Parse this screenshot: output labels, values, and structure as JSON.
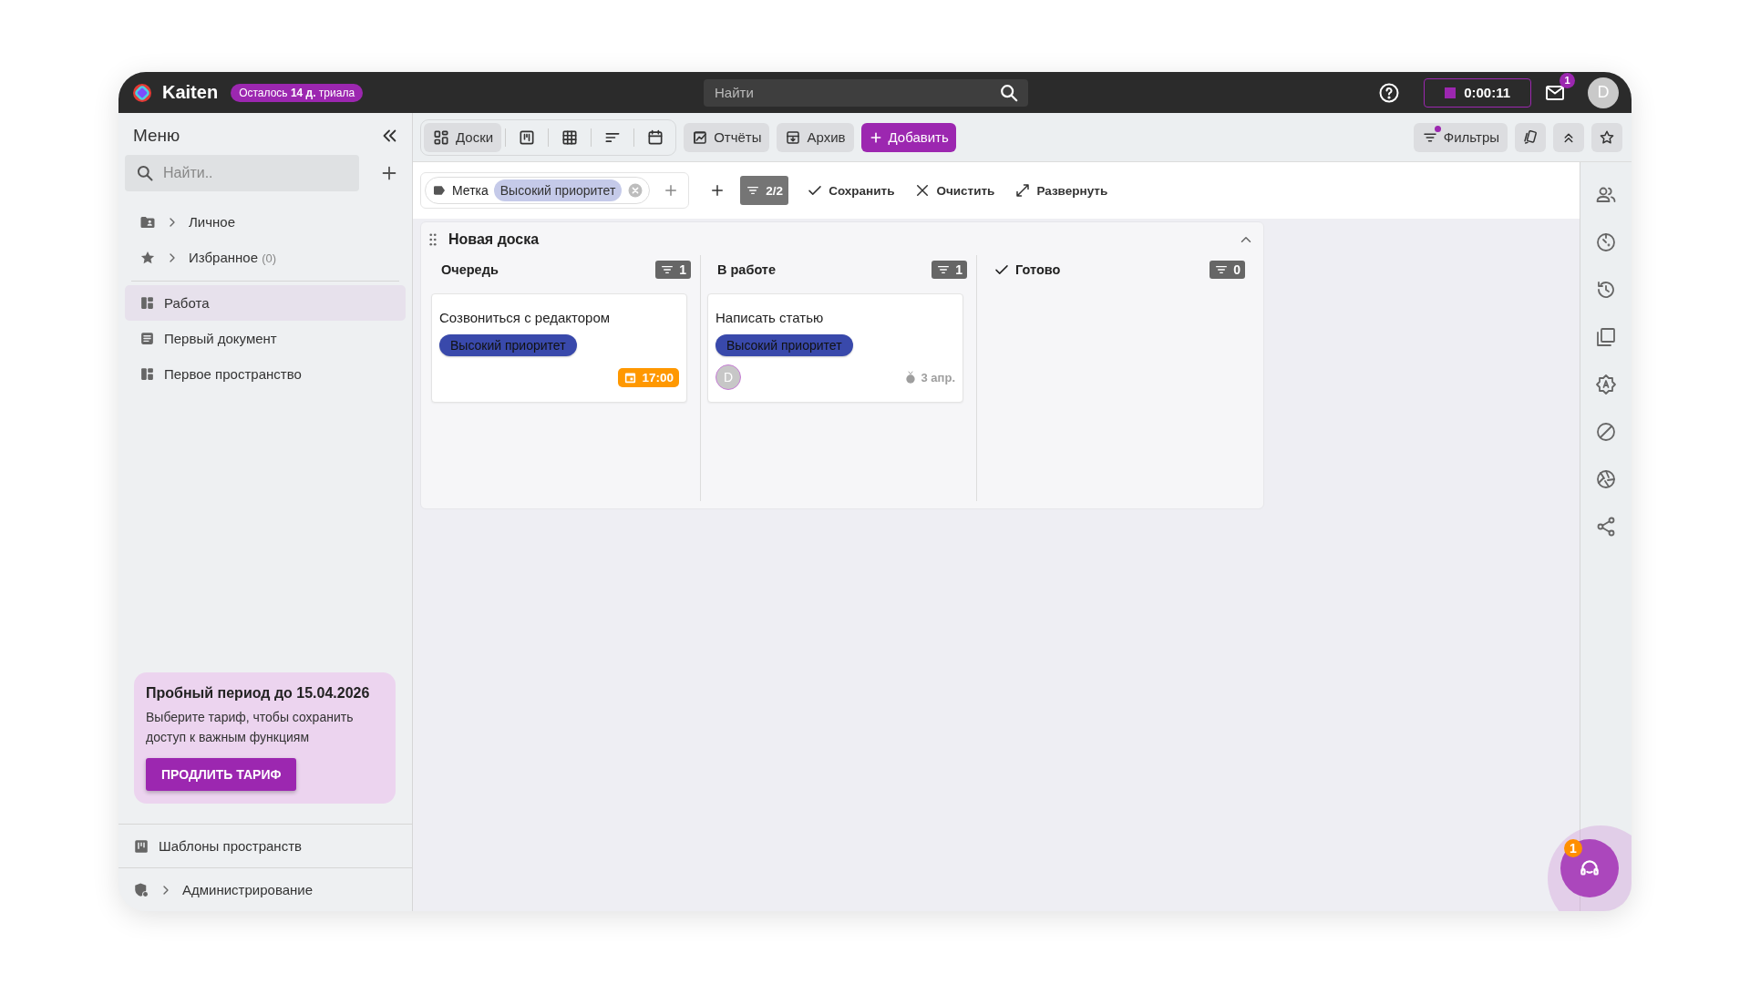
{
  "topbar": {
    "logo": "Kaiten",
    "trial_badge": "Осталось **14 д.** триала",
    "search": {
      "placeholder": "Найти"
    },
    "timer": "0:00:11",
    "mail_badge": "1",
    "avatar": "D"
  },
  "sidebar": {
    "title": "Меню",
    "search": {
      "placeholder": "Найти.."
    },
    "sections": [
      {
        "label": "Личное",
        "kind": "personal",
        "expanded": false
      },
      {
        "label": "Избранное",
        "count": "(0)",
        "kind": "favorites",
        "expanded": false
      }
    ],
    "items": [
      {
        "label": "Работа",
        "kind": "board",
        "selected": true
      },
      {
        "label": "Первый документ",
        "kind": "document",
        "selected": false
      },
      {
        "label": "Первое пространство",
        "kind": "board",
        "selected": false
      }
    ],
    "trial_card": {
      "title": "Пробный период до 15.04.2026",
      "text": "Выберите тариф, чтобы сохранить доступ к важным функциям",
      "button": "ПРОДЛИТЬ ТАРИФ"
    },
    "footer": [
      {
        "label": "Шаблоны пространств",
        "kind": "templates",
        "expandable": false
      },
      {
        "label": "Администрирование",
        "kind": "admin",
        "expandable": true
      }
    ]
  },
  "toolbar": {
    "views": [
      {
        "label": "Доски",
        "kind": "boards",
        "selected": true
      },
      {
        "kind": "kanban",
        "selected": false
      },
      {
        "kind": "table",
        "selected": false
      },
      {
        "kind": "list",
        "selected": false
      },
      {
        "kind": "calendar",
        "selected": false
      }
    ],
    "buttons": [
      {
        "label": "Отчёты",
        "kind": "reports"
      },
      {
        "label": "Архив",
        "kind": "archive"
      }
    ],
    "add_button": "Добавить",
    "filters": {
      "label": "Фильтры",
      "active": true
    }
  },
  "filter_bar": {
    "chip": {
      "label": "Метка",
      "value": "Высокий приоритет"
    },
    "count": "2/2",
    "actions": [
      {
        "label": "Сохранить",
        "kind": "save"
      },
      {
        "label": "Очистить",
        "kind": "clear"
      },
      {
        "label": "Развернуть",
        "kind": "expand"
      }
    ]
  },
  "board": {
    "title": "Новая доска",
    "expanded": true,
    "columns": [
      {
        "title": "Очередь",
        "done": false,
        "count": "1",
        "cards": [
          {
            "title": "Созвониться с редактором",
            "tags": [
              "Высокий приоритет"
            ],
            "due": "17:00"
          }
        ]
      },
      {
        "title": "В работе",
        "done": false,
        "count": "1",
        "cards": [
          {
            "title": "Написать статью",
            "tags": [
              "Высокий приоритет"
            ],
            "avatar": "D",
            "date": "3 апр."
          }
        ]
      },
      {
        "title": "Готово",
        "done": true,
        "count": "0"
      }
    ]
  },
  "support_badge": "1"
}
